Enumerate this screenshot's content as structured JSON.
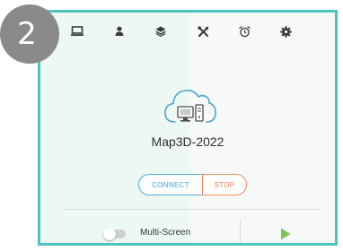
{
  "step_badge": "2",
  "toolbar": {
    "items": [
      {
        "name": "monitor-icon"
      },
      {
        "name": "user-icon"
      },
      {
        "name": "layers-icon"
      },
      {
        "name": "tools-icon"
      },
      {
        "name": "alarm-clock-icon"
      },
      {
        "name": "gear-icon"
      }
    ],
    "icon_color": "#3a3a3a"
  },
  "app": {
    "icon": "cloud-computer-icon",
    "name": "Map3D-2022"
  },
  "actions": {
    "connect_label": "CONNECT",
    "stop_label": "STOP",
    "connect_color": "#3ea4d4",
    "stop_color": "#ec7a52"
  },
  "footer": {
    "multi_screen_label": "Multi-Screen",
    "multi_screen_on": false,
    "play_icon": "play-icon",
    "play_color": "#7dc35a"
  },
  "colors": {
    "border": "#4cc3bd",
    "badge": "#8a8a8a"
  }
}
